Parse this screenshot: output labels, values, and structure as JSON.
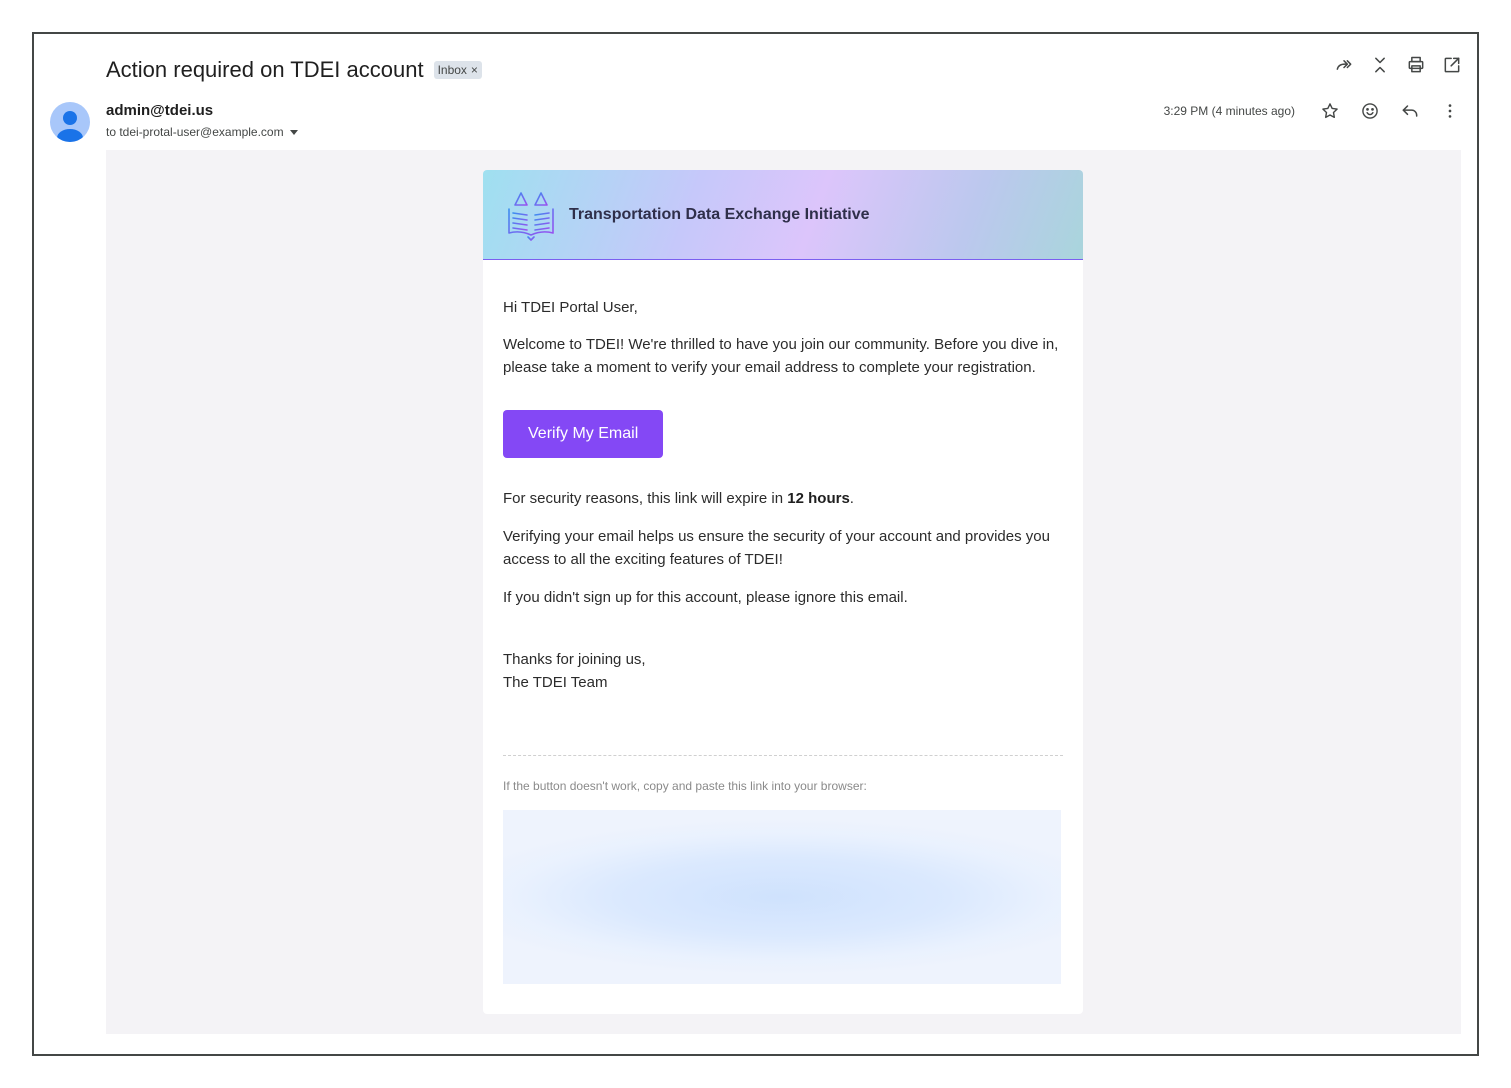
{
  "email": {
    "subject": "Action required on TDEI account",
    "label": "Inbox",
    "label_remove": "×",
    "sender": "admin@tdei.us",
    "recipient": "to tdei-protal-user@example.com",
    "time": "3:29 PM (4 minutes ago)"
  },
  "actions": {
    "top": [
      "forward-all-icon",
      "collapse-icon",
      "print-icon",
      "open-new-window-icon"
    ],
    "message": [
      "star-icon",
      "emoji-icon",
      "reply-icon",
      "more-vert-icon"
    ]
  },
  "card": {
    "brand": "Transportation Data Exchange Initiative",
    "greeting": "Hi TDEI Portal User,",
    "welcome": "Welcome to TDEI! We're thrilled to have you join our community. Before you dive in, please take a moment to verify your email address to complete your registration.",
    "button": "Verify My Email",
    "security_prefix": "For security reasons, this link will expire in ",
    "security_bold": "12 hours",
    "security_suffix": ".",
    "verifying": "Verifying your email helps us ensure the security of your account and provides you access to all the exciting features of TDEI!",
    "ignore": "If you didn't sign up for this account, please ignore this email.",
    "thanks": "Thanks for joining us,",
    "team": "The TDEI Team",
    "fallback": "If the button doesn't work, copy and paste this link into your browser:"
  },
  "colors": {
    "accent": "#8448f5",
    "canvas": "#f4f3f6",
    "avatar": "#a8c7fa"
  }
}
